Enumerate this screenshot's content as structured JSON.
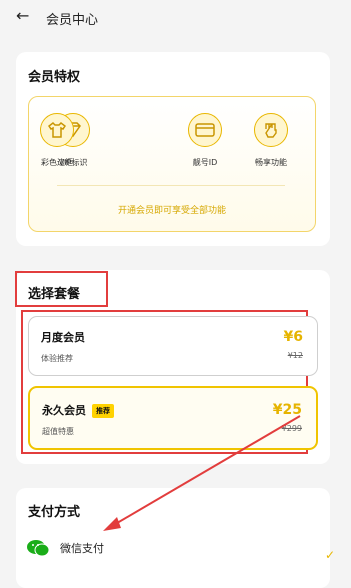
{
  "header": {
    "title": "会员中心"
  },
  "privileges": {
    "title": "会员特权",
    "items": [
      {
        "label": "VIP标识",
        "icon": "diamond-icon"
      },
      {
        "label": "彩色边框",
        "icon": "shirt-icon"
      },
      {
        "label": "靓号ID",
        "icon": "card-icon"
      },
      {
        "label": "畅享功能",
        "icon": "fist-icon"
      }
    ],
    "unlock_text": "开通会员即可享受全部功能"
  },
  "plans": {
    "title": "选择套餐",
    "items": [
      {
        "name": "月度会员",
        "subtitle": "体验推荐",
        "price": "¥6",
        "original_price": "¥12",
        "badge": ""
      },
      {
        "name": "永久会员",
        "subtitle": "超值特惠",
        "price": "¥25",
        "original_price": "¥299",
        "badge": "推荐"
      }
    ]
  },
  "payment": {
    "title": "支付方式",
    "methods": [
      {
        "label": "微信支付",
        "icon": "wechat-icon",
        "selected": true
      }
    ]
  },
  "colors": {
    "accent": "#e6b400",
    "highlight_box": "#e23d3d",
    "wechat": "#1aad19"
  }
}
